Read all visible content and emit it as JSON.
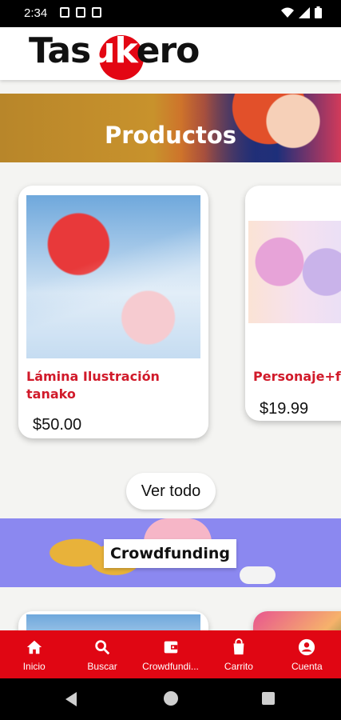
{
  "status_bar": {
    "time": "2:34"
  },
  "header": {
    "logo_text": "Tasukero",
    "logo_pre": "Tas",
    "logo_mid": "uk",
    "logo_post": "ero"
  },
  "banner": {
    "title": "Productos"
  },
  "products": [
    {
      "name": "Lámina Ilustración tanako",
      "price": "$50.00"
    },
    {
      "name": "Personaje+fl",
      "price": "$19.99"
    }
  ],
  "see_all_label": "Ver todo",
  "crowdfunding": {
    "label": "Crowdfunding"
  },
  "nav": [
    {
      "label": "Inicio",
      "icon": "home-icon"
    },
    {
      "label": "Buscar",
      "icon": "search-icon"
    },
    {
      "label": "Crowdfundi...",
      "icon": "wallet-icon"
    },
    {
      "label": "Carrito",
      "icon": "shopping-bag-icon"
    },
    {
      "label": "Cuenta",
      "icon": "account-icon"
    }
  ],
  "colors": {
    "brand_red": "#e00613",
    "product_name": "#d11a2a"
  }
}
